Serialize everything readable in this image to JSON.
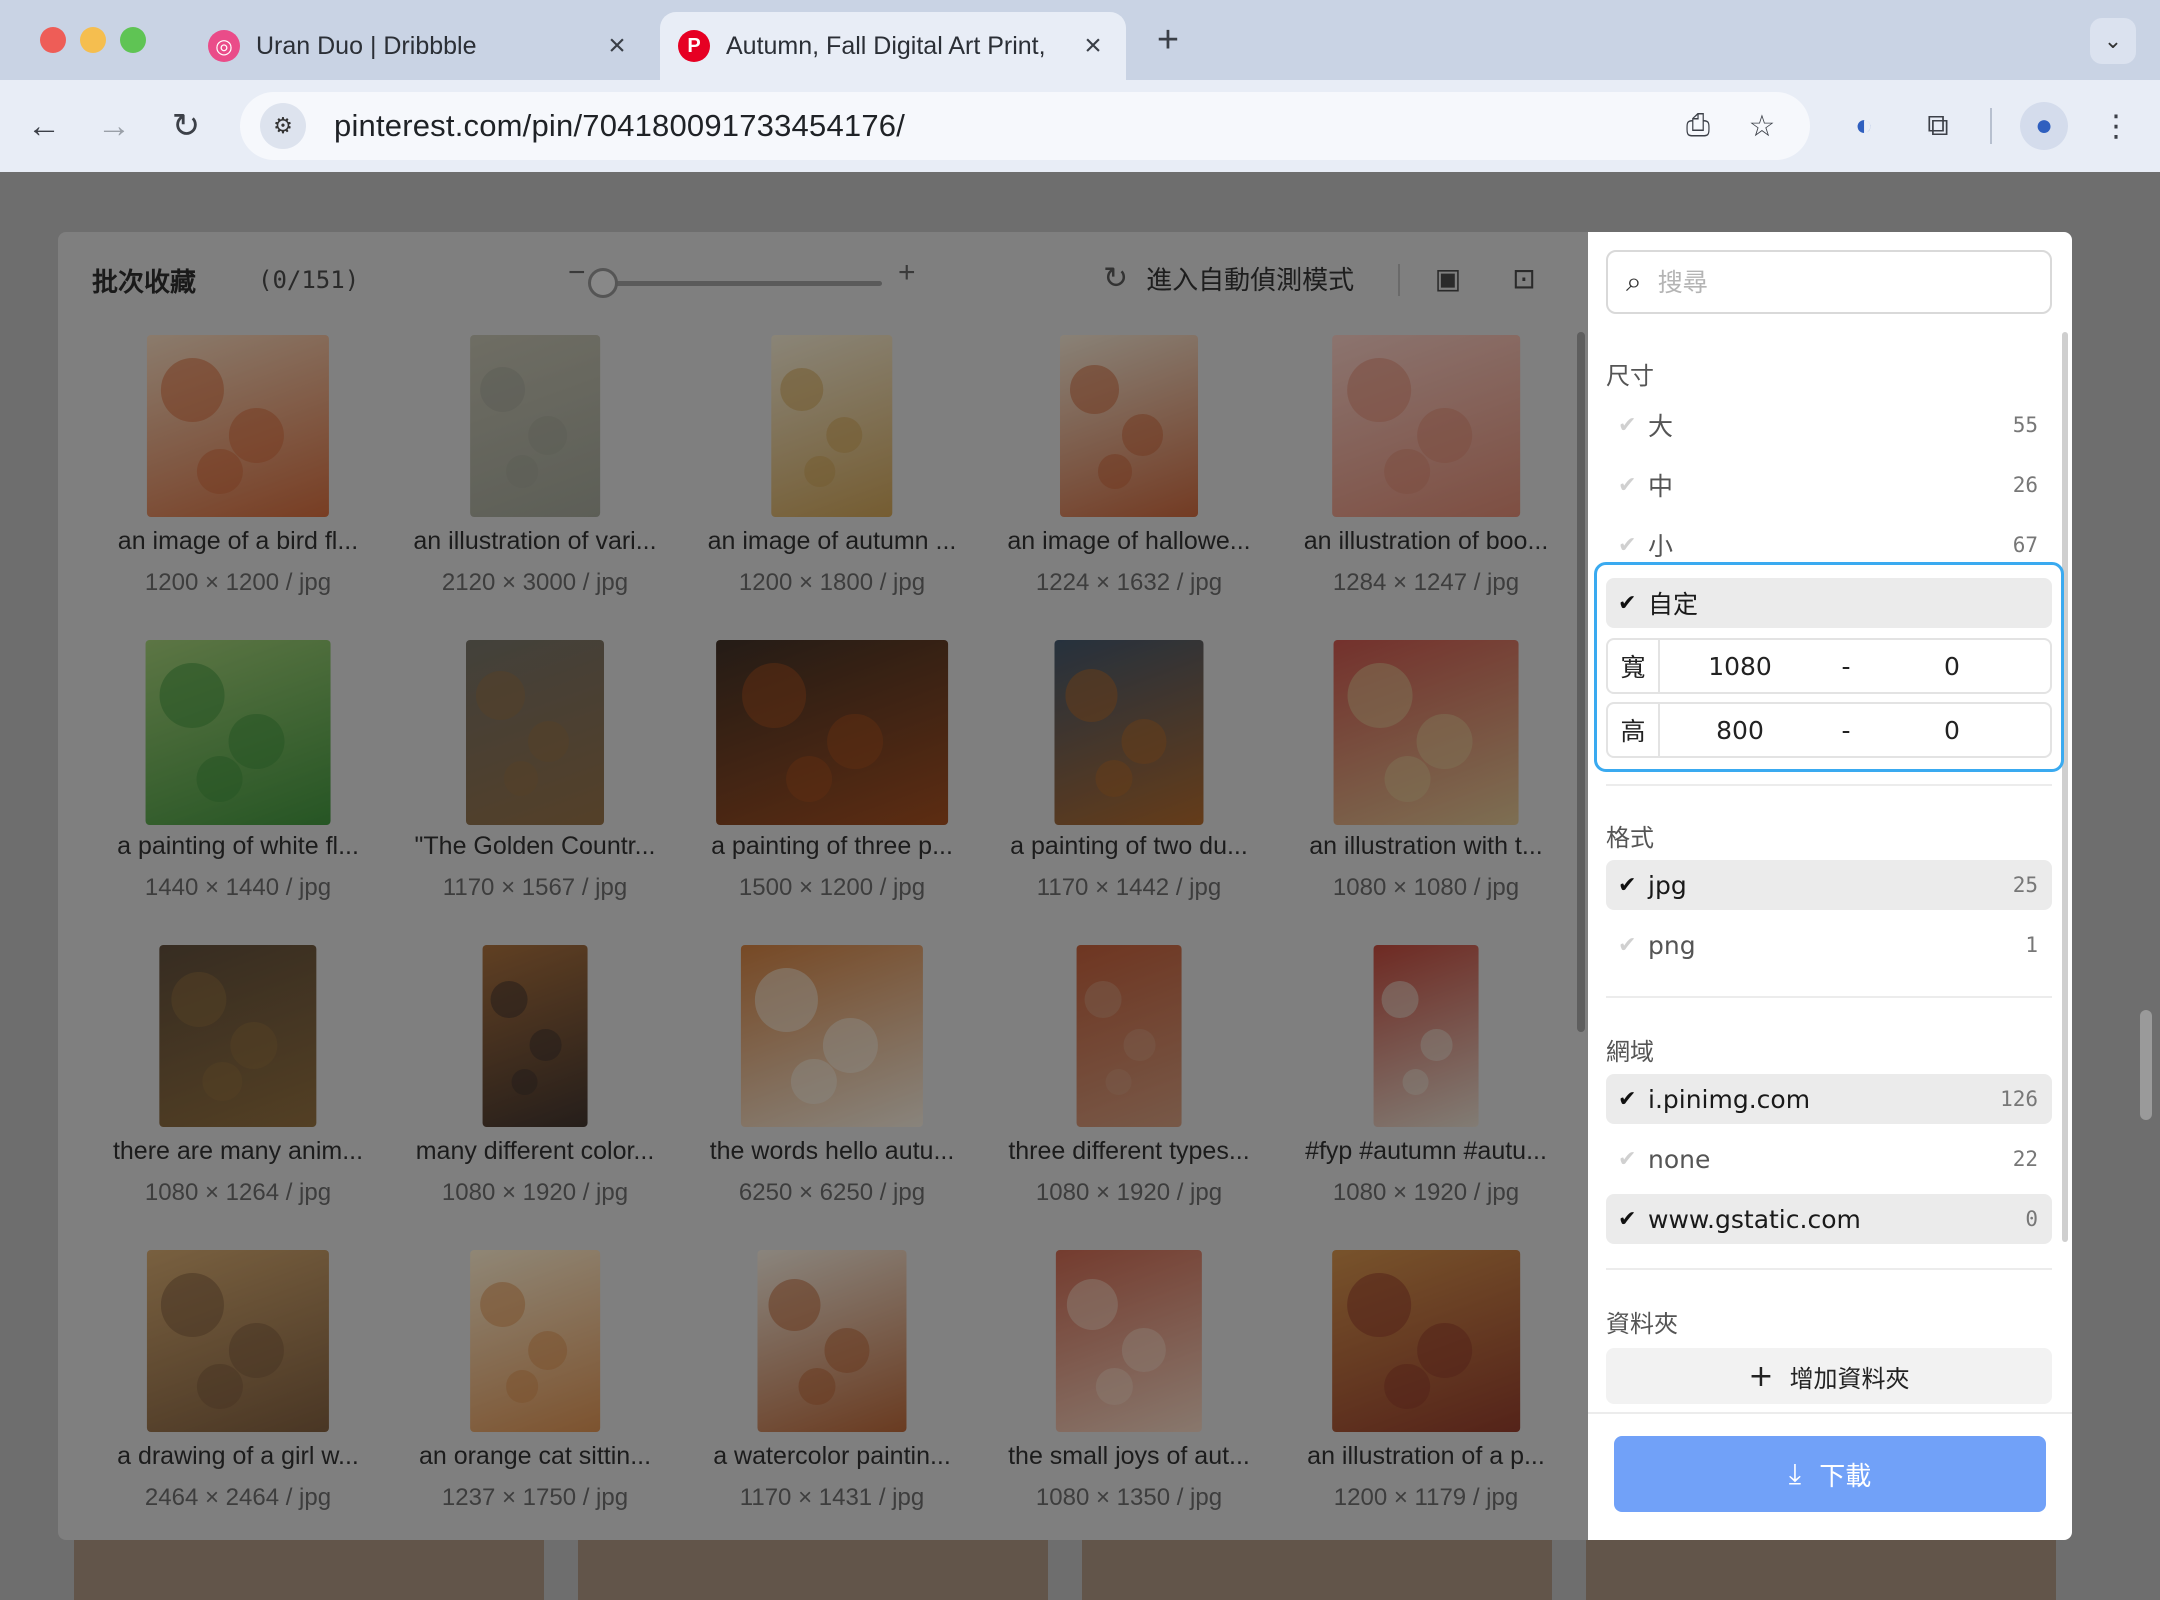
{
  "browser": {
    "tabs": [
      {
        "title": "Uran Duo | Dribbble",
        "favicon": "dribbble-icon",
        "active": false
      },
      {
        "title": "Autumn, Fall Digital Art Print,",
        "favicon": "pinterest-icon",
        "active": true
      }
    ],
    "url": "pinterest.com/pin/704180091733454176/"
  },
  "modal": {
    "title": "批次收藏",
    "count": "(0/151)",
    "auto_detect_label": "進入自動偵測模式",
    "images": [
      {
        "caption": "an image of a bird fl...",
        "meta": "1200 × 1200 / jpg",
        "c1": "#c8663a",
        "c2": "#e7cdb4",
        "tw": 132,
        "th": 132
      },
      {
        "caption": "an illustration of vari...",
        "meta": "2120 × 3000 / jpg",
        "c1": "#9a9d90",
        "c2": "#b8b6a6",
        "tw": 94,
        "th": 132
      },
      {
        "caption": "an image of autumn ...",
        "meta": "1200 × 1800 / jpg",
        "c1": "#c39a52",
        "c2": "#e6ddc7",
        "tw": 88,
        "th": 132
      },
      {
        "caption": "an image of hallowe...",
        "meta": "1224 × 1632 / jpg",
        "c1": "#c0623a",
        "c2": "#e4d8c6",
        "tw": 100,
        "th": 132
      },
      {
        "caption": "an illustration of boo...",
        "meta": "1284 × 1247 / jpg",
        "c1": "#d2836e",
        "c2": "#e8c1b8",
        "tw": 136,
        "th": 132
      },
      {
        "caption": "a painting of white fl...",
        "meta": "1440 × 1440 / jpg",
        "c1": "#3f8e3c",
        "c2": "#9ac472",
        "tw": 134,
        "th": 134
      },
      {
        "caption": "\"The Golden Countr...",
        "meta": "1170 × 1567 / jpg",
        "c1": "#8c6a43",
        "c2": "#6f6c62",
        "tw": 100,
        "th": 134
      },
      {
        "caption": "a painting of three p...",
        "meta": "1500 × 1200 / jpg",
        "c1": "#9b4a1e",
        "c2": "#3c2e24",
        "tw": 168,
        "th": 134
      },
      {
        "caption": "a painting of two du...",
        "meta": "1170 × 1442 / jpg",
        "c1": "#a8642a",
        "c2": "#3f5266",
        "tw": 108,
        "th": 134
      },
      {
        "caption": "an illustration with t...",
        "meta": "1080 × 1080 / jpg",
        "c1": "#d1b98a",
        "c2": "#c1524a",
        "tw": 134,
        "th": 134
      },
      {
        "caption": "there are many anim...",
        "meta": "1080 × 1264 / jpg",
        "c1": "#8b6a3c",
        "c2": "#5b4a38",
        "tw": 114,
        "th": 132
      },
      {
        "caption": "many different color...",
        "meta": "1080 × 1920 / jpg",
        "c1": "#3e322c",
        "c2": "#a06a3a",
        "tw": 76,
        "th": 132
      },
      {
        "caption": "the words hello autu...",
        "meta": "6250 × 6250 / jpg",
        "c1": "#e4dccf",
        "c2": "#c67a3e",
        "tw": 132,
        "th": 132
      },
      {
        "caption": "three different types...",
        "meta": "1080 × 1920 / jpg",
        "c1": "#c79478",
        "c2": "#b85a38",
        "tw": 76,
        "th": 132
      },
      {
        "caption": "#fyp #autumn #autu...",
        "meta": "1080 × 1920 / jpg",
        "c1": "#d8cfc2",
        "c2": "#b8463a",
        "tw": 76,
        "th": 132
      },
      {
        "caption": "a drawing of a girl w...",
        "meta": "2464 × 2464 / jpg",
        "c1": "#7a5a3c",
        "c2": "#c9a06a",
        "tw": 132,
        "th": 132
      },
      {
        "caption": "an orange cat sittin...",
        "meta": "1237 × 1750 / jpg",
        "c1": "#d08a4e",
        "c2": "#efe0c4",
        "tw": 94,
        "th": 132
      },
      {
        "caption": "a watercolor paintin...",
        "meta": "1170 × 1431 / jpg",
        "c1": "#b06236",
        "c2": "#e6ddd0",
        "tw": 108,
        "th": 132
      },
      {
        "caption": "the small joys of aut...",
        "meta": "1080 × 1350 / jpg",
        "c1": "#e3c8b6",
        "c2": "#c2644e",
        "tw": 106,
        "th": 132
      },
      {
        "caption": "an illustration of a p...",
        "meta": "1200 × 1179 / jpg",
        "c1": "#8c3a2a",
        "c2": "#c88a48",
        "tw": 136,
        "th": 132
      }
    ]
  },
  "panel": {
    "search_placeholder": "搜尋",
    "size": {
      "title": "尺寸",
      "options": [
        {
          "label": "大",
          "count": "55",
          "checked": false
        },
        {
          "label": "中",
          "count": "26",
          "checked": false
        },
        {
          "label": "小",
          "count": "67",
          "checked": false
        },
        {
          "label": "自定",
          "count": "",
          "checked": true
        }
      ],
      "width": {
        "label": "寬",
        "min": "1080",
        "max": "0"
      },
      "height": {
        "label": "高",
        "min": "800",
        "max": "0"
      },
      "dash": "-"
    },
    "format": {
      "title": "格式",
      "options": [
        {
          "label": "jpg",
          "count": "25",
          "checked": true
        },
        {
          "label": "png",
          "count": "1",
          "checked": false
        }
      ]
    },
    "domain": {
      "title": "網域",
      "options": [
        {
          "label": "i.pinimg.com",
          "count": "126",
          "checked": true
        },
        {
          "label": "none",
          "count": "22",
          "checked": false
        },
        {
          "label": "www.gstatic.com",
          "count": "0",
          "checked": true
        }
      ]
    },
    "folder": {
      "title": "資料夾",
      "add_label": "增加資料夾"
    },
    "download_label": "下載"
  },
  "colors": {
    "accent": "#3aaaf0",
    "download": "#71a1f8"
  }
}
